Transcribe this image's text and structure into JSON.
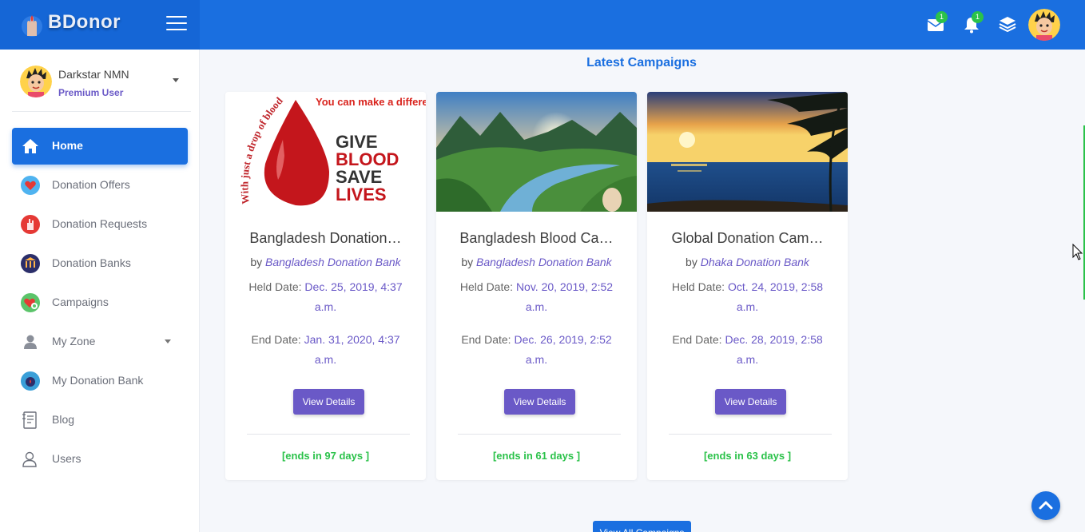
{
  "app": {
    "name": "BDonor"
  },
  "topbar": {
    "messages_badge": "1",
    "notifications_badge": "1"
  },
  "user": {
    "name": "Darkstar NMN",
    "role": "Premium User"
  },
  "sidebar": {
    "items": [
      {
        "label": "Home",
        "icon": "home-icon",
        "active": true
      },
      {
        "label": "Donation Offers",
        "icon": "heart-hand-icon"
      },
      {
        "label": "Donation Requests",
        "icon": "hand-request-icon"
      },
      {
        "label": "Donation Banks",
        "icon": "bank-icon"
      },
      {
        "label": "Campaigns",
        "icon": "campaign-icon"
      },
      {
        "label": "My Zone",
        "icon": "person-icon",
        "has_submenu": true
      },
      {
        "label": "My Donation Bank",
        "icon": "donation-bank-icon"
      },
      {
        "label": "Blog",
        "icon": "blog-icon"
      },
      {
        "label": "Users",
        "icon": "users-icon"
      }
    ]
  },
  "main": {
    "section_title": "Latest Campaigns",
    "view_all_label": "View All Campaigns",
    "cards": [
      {
        "title": "Bangladesh Donation…",
        "by_prefix": "by",
        "by": "Bangladesh Donation Bank",
        "held_label": "Held Date:",
        "held_date": "Dec. 25, 2019, 4:37 a.m.",
        "end_label": "End Date:",
        "end_date": "Jan. 31, 2020, 4:37 a.m.",
        "button": "View Details",
        "ends": "[ends in 97 days ]",
        "image": "give-blood-poster",
        "image_text": {
          "arc": "With just a drop of blood,",
          "tag": "You can make a difference.",
          "line1": "GIVE",
          "line2": "BLOOD",
          "line3": "SAVE",
          "line4": "LIVES"
        }
      },
      {
        "title": "Bangladesh Blood Ca…",
        "by_prefix": "by",
        "by": "Bangladesh Donation Bank",
        "held_label": "Held Date:",
        "held_date": "Nov. 20, 2019, 2:52 a.m.",
        "end_label": "End Date:",
        "end_date": "Dec. 26, 2019, 2:52 a.m.",
        "button": "View Details",
        "ends": "[ends in 61 days ]",
        "image": "valley-landscape"
      },
      {
        "title": "Global Donation Cam…",
        "by_prefix": "by",
        "by": "Dhaka Donation Bank",
        "held_label": "Held Date:",
        "held_date": "Oct. 24, 2019, 2:58 a.m.",
        "end_label": "End Date:",
        "end_date": "Dec. 28, 2019, 2:58 a.m.",
        "button": "View Details",
        "ends": "[ends in 63 days ]",
        "image": "sunset-beach"
      }
    ]
  },
  "colors": {
    "primary": "#1a6fe0",
    "accent": "#6a59c7",
    "success": "#2bc24a"
  }
}
